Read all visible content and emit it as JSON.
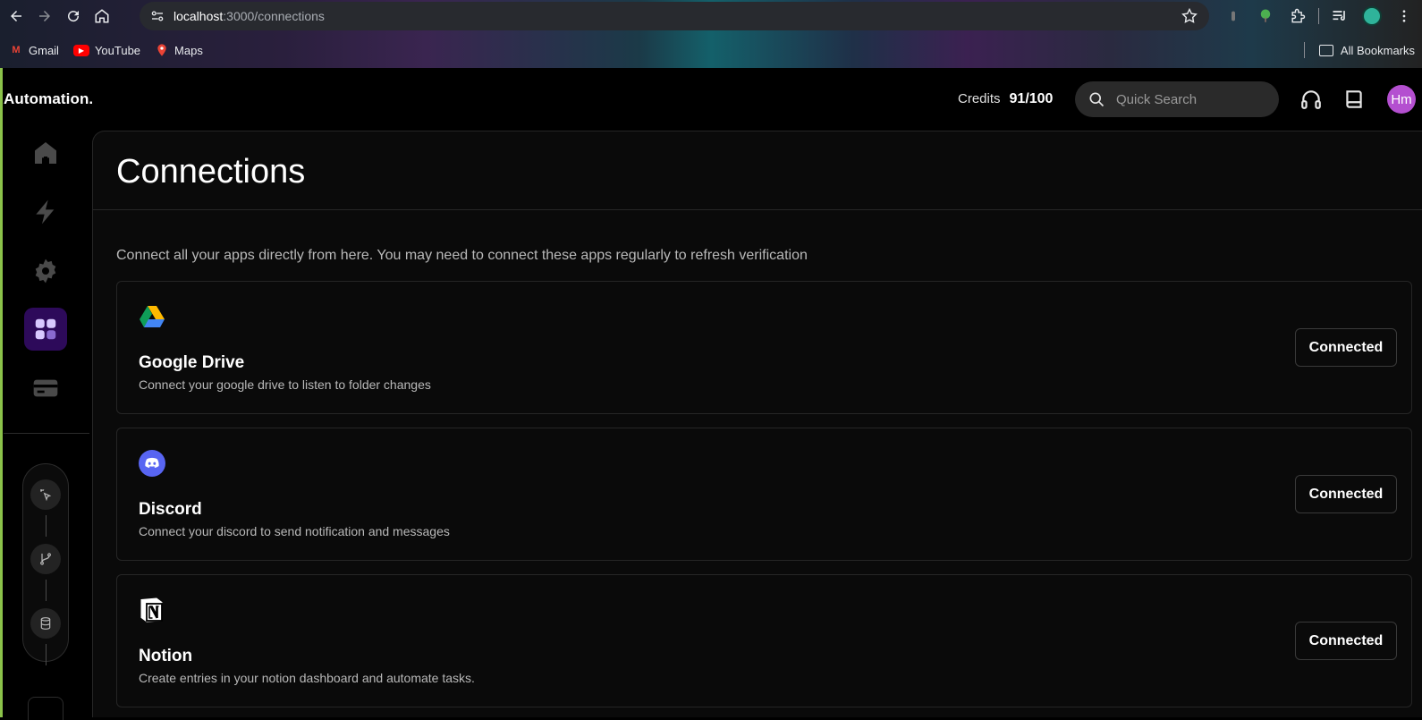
{
  "browser": {
    "url_host": "localhost",
    "url_path": ":3000/connections",
    "bookmarks": [
      "Gmail",
      "YouTube",
      "Maps"
    ],
    "all_bookmarks": "All Bookmarks"
  },
  "app": {
    "brand": "Automation.",
    "credits_label": "Credits",
    "credits_value": "91/100",
    "search_placeholder": "Quick Search",
    "avatar_initials": "Hm"
  },
  "page": {
    "title": "Connections",
    "intro": "Connect all your apps directly from here. You may need to connect these apps regularly to refresh verification"
  },
  "connections": [
    {
      "name": "Google Drive",
      "description": "Connect your google drive to listen to folder changes",
      "status": "Connected",
      "icon": "google-drive-icon"
    },
    {
      "name": "Discord",
      "description": "Connect your discord to send notification and messages",
      "status": "Connected",
      "icon": "discord-icon"
    },
    {
      "name": "Notion",
      "description": "Create entries in your notion dashboard and automate tasks.",
      "status": "Connected",
      "icon": "notion-icon"
    }
  ],
  "colors": {
    "active_nav": "#2d0a5a",
    "avatar": "#b44fd0",
    "discord": "#5865f2"
  }
}
